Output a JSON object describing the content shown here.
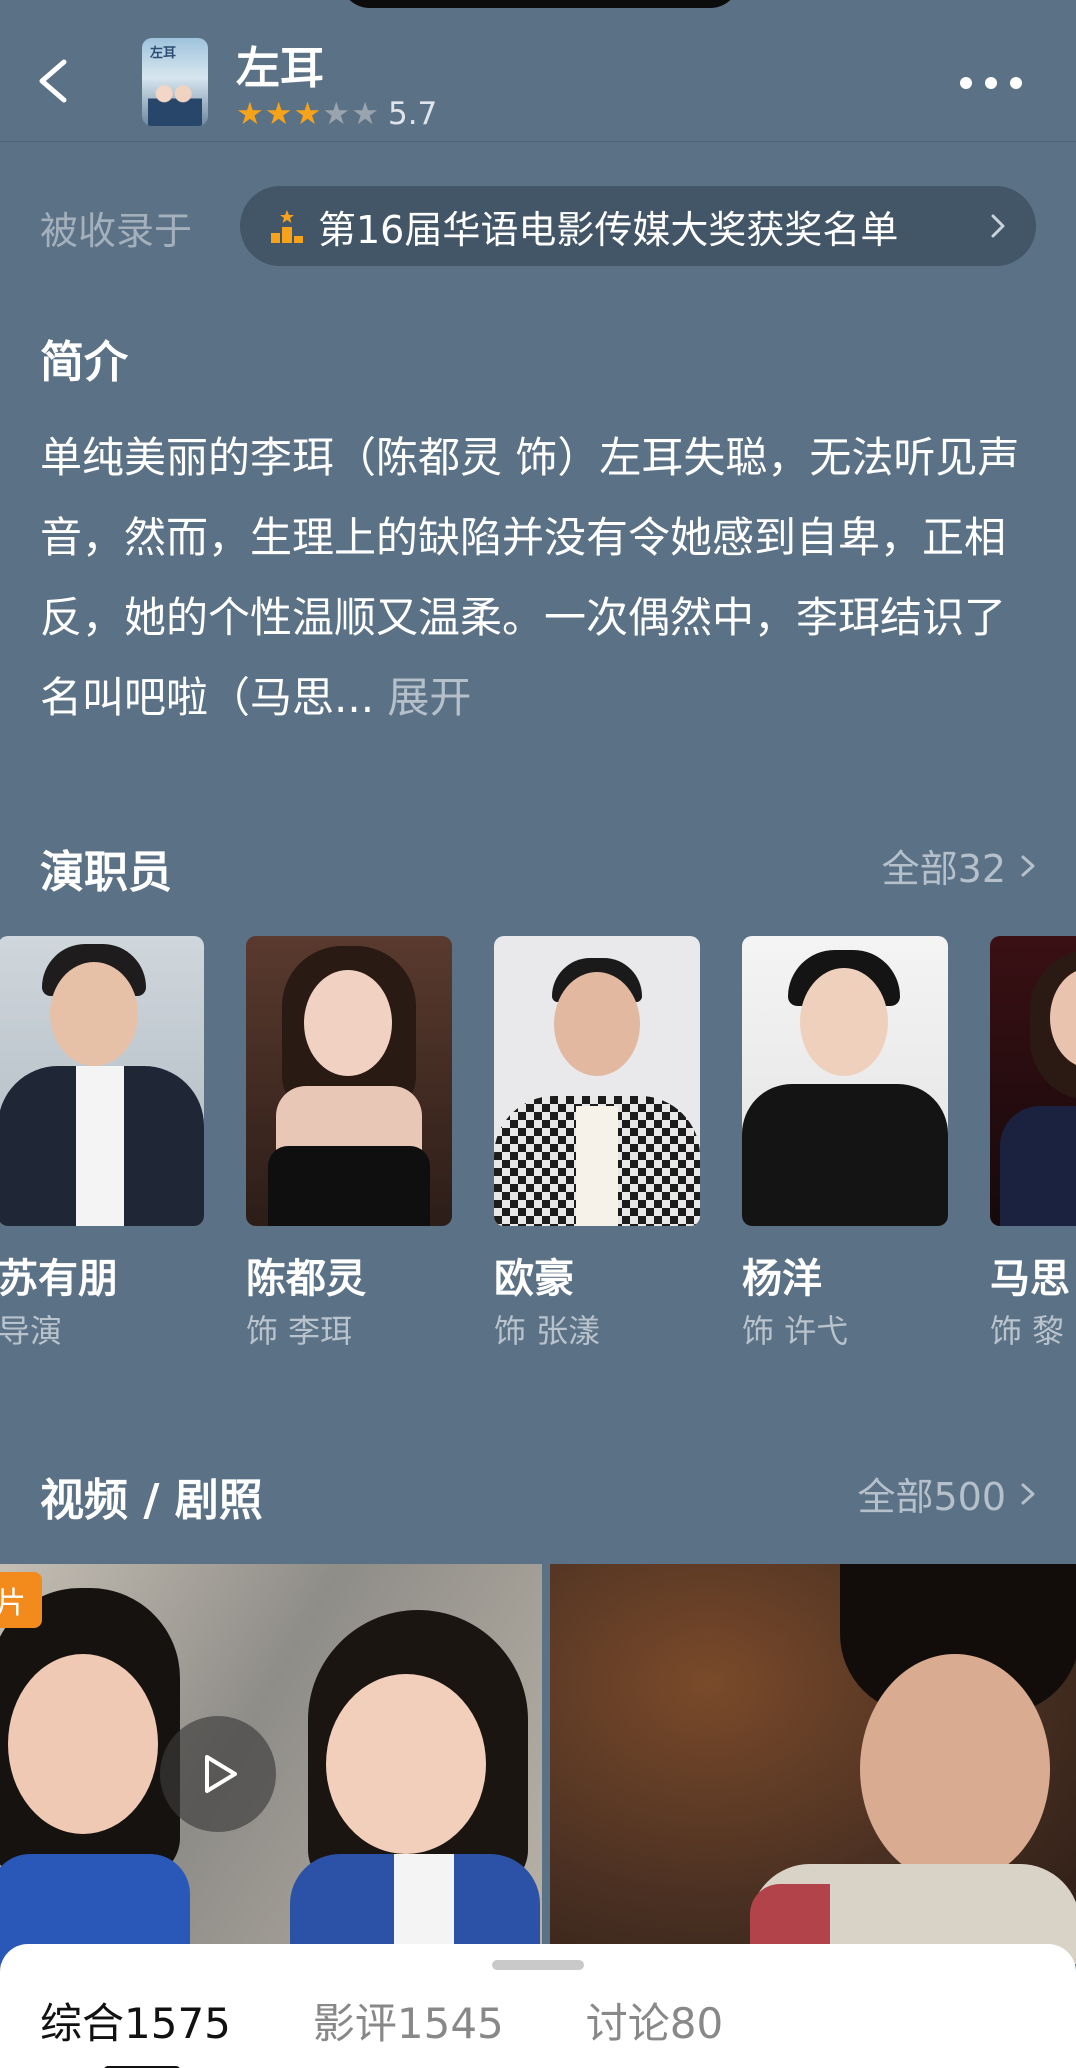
{
  "header": {
    "title": "左耳",
    "poster_text": "左耳",
    "rating": 5.7,
    "rating_text": "5.7",
    "stars": {
      "filled": 3,
      "total": 5
    }
  },
  "collected": {
    "label": "被收录于",
    "list_name": "第16届华语电影传媒大奖获奖名单"
  },
  "synopsis": {
    "title": "简介",
    "text": "单纯美丽的李珥（陈都灵 饰）左耳失聪，无法听见声音，然而，生理上的缺陷并没有令她感到自卑，正相反，她的个性温顺又温柔。一次偶然中，李珥结识了名叫吧啦（马思...",
    "expand_label": "展开"
  },
  "cast": {
    "title": "演职员",
    "all_label": "全部32",
    "members": [
      {
        "name": "苏有朋",
        "role": "导演"
      },
      {
        "name": "陈都灵",
        "role": "饰 李珥"
      },
      {
        "name": "欧豪",
        "role": "饰 张漾"
      },
      {
        "name": "杨洋",
        "role": "饰 许弋"
      },
      {
        "name": "马思",
        "role": "饰 黎"
      }
    ]
  },
  "media": {
    "title": "视频 / 剧照",
    "all_label": "全部500",
    "badge": "片"
  },
  "bottom_tabs": [
    {
      "label": "综合1575",
      "active": true
    },
    {
      "label": "影评1545",
      "active": false
    },
    {
      "label": "讨论80",
      "active": false
    }
  ],
  "colors": {
    "background": "#5b7185",
    "star_on": "#f7a21b",
    "badge": "#f28a1c"
  }
}
